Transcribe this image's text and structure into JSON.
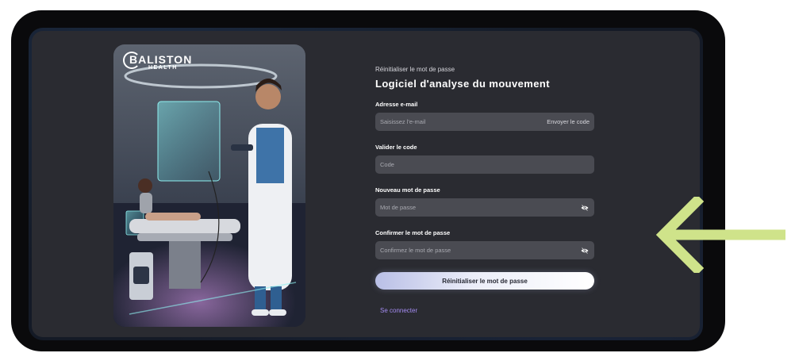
{
  "brand": {
    "name": "BALISTON",
    "sub": "HEALTH"
  },
  "form": {
    "eyebrow": "Réinitialiser le mot de passe",
    "title": "Logiciel d'analyse du mouvement",
    "email": {
      "label": "Adresse e-mail",
      "placeholder": "Saisissez l'e-mail",
      "action": "Envoyer le code"
    },
    "code": {
      "label": "Valider le code",
      "placeholder": "Code"
    },
    "new_password": {
      "label": "Nouveau mot de passe",
      "placeholder": "Mot de passe",
      "icon": "eye-slash-icon"
    },
    "confirm_password": {
      "label": "Confirmer le mot de passe",
      "placeholder": "Confirmez le mot de passe",
      "icon": "eye-slash-icon"
    },
    "submit_label": "Réinitialiser le mot de passe",
    "login_link": "Se connecter"
  },
  "colors": {
    "accent": "#a38bf0",
    "arrow": "#cfe38a",
    "panel": "#2a2b31",
    "field": "#4a4b52"
  }
}
